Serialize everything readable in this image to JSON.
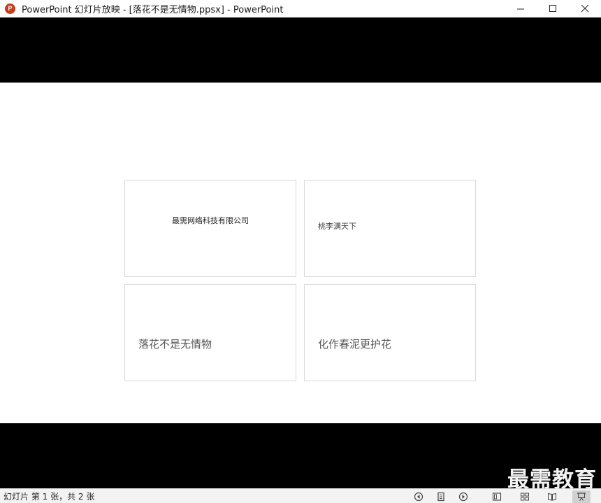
{
  "window": {
    "title": "PowerPoint 幻灯片放映 - [落花不是无情物.ppsx] - PowerPoint",
    "app_icon_letter": "P",
    "accent_color": "#c43e1c"
  },
  "slide": {
    "cards": [
      {
        "text": "最需网络科技有限公司"
      },
      {
        "text": "桃李满天下"
      },
      {
        "text": "落花不是无情物"
      },
      {
        "text": "化作春泥更护花"
      }
    ]
  },
  "watermark": "最需教育",
  "statusbar": {
    "slide_info": "幻灯片 第 1 张，共 2 张",
    "icons": [
      "previous-slide-icon",
      "slide-menu-icon",
      "next-slide-icon",
      "normal-view-icon",
      "slide-sorter-icon",
      "reading-view-icon",
      "slide-show-icon"
    ]
  }
}
